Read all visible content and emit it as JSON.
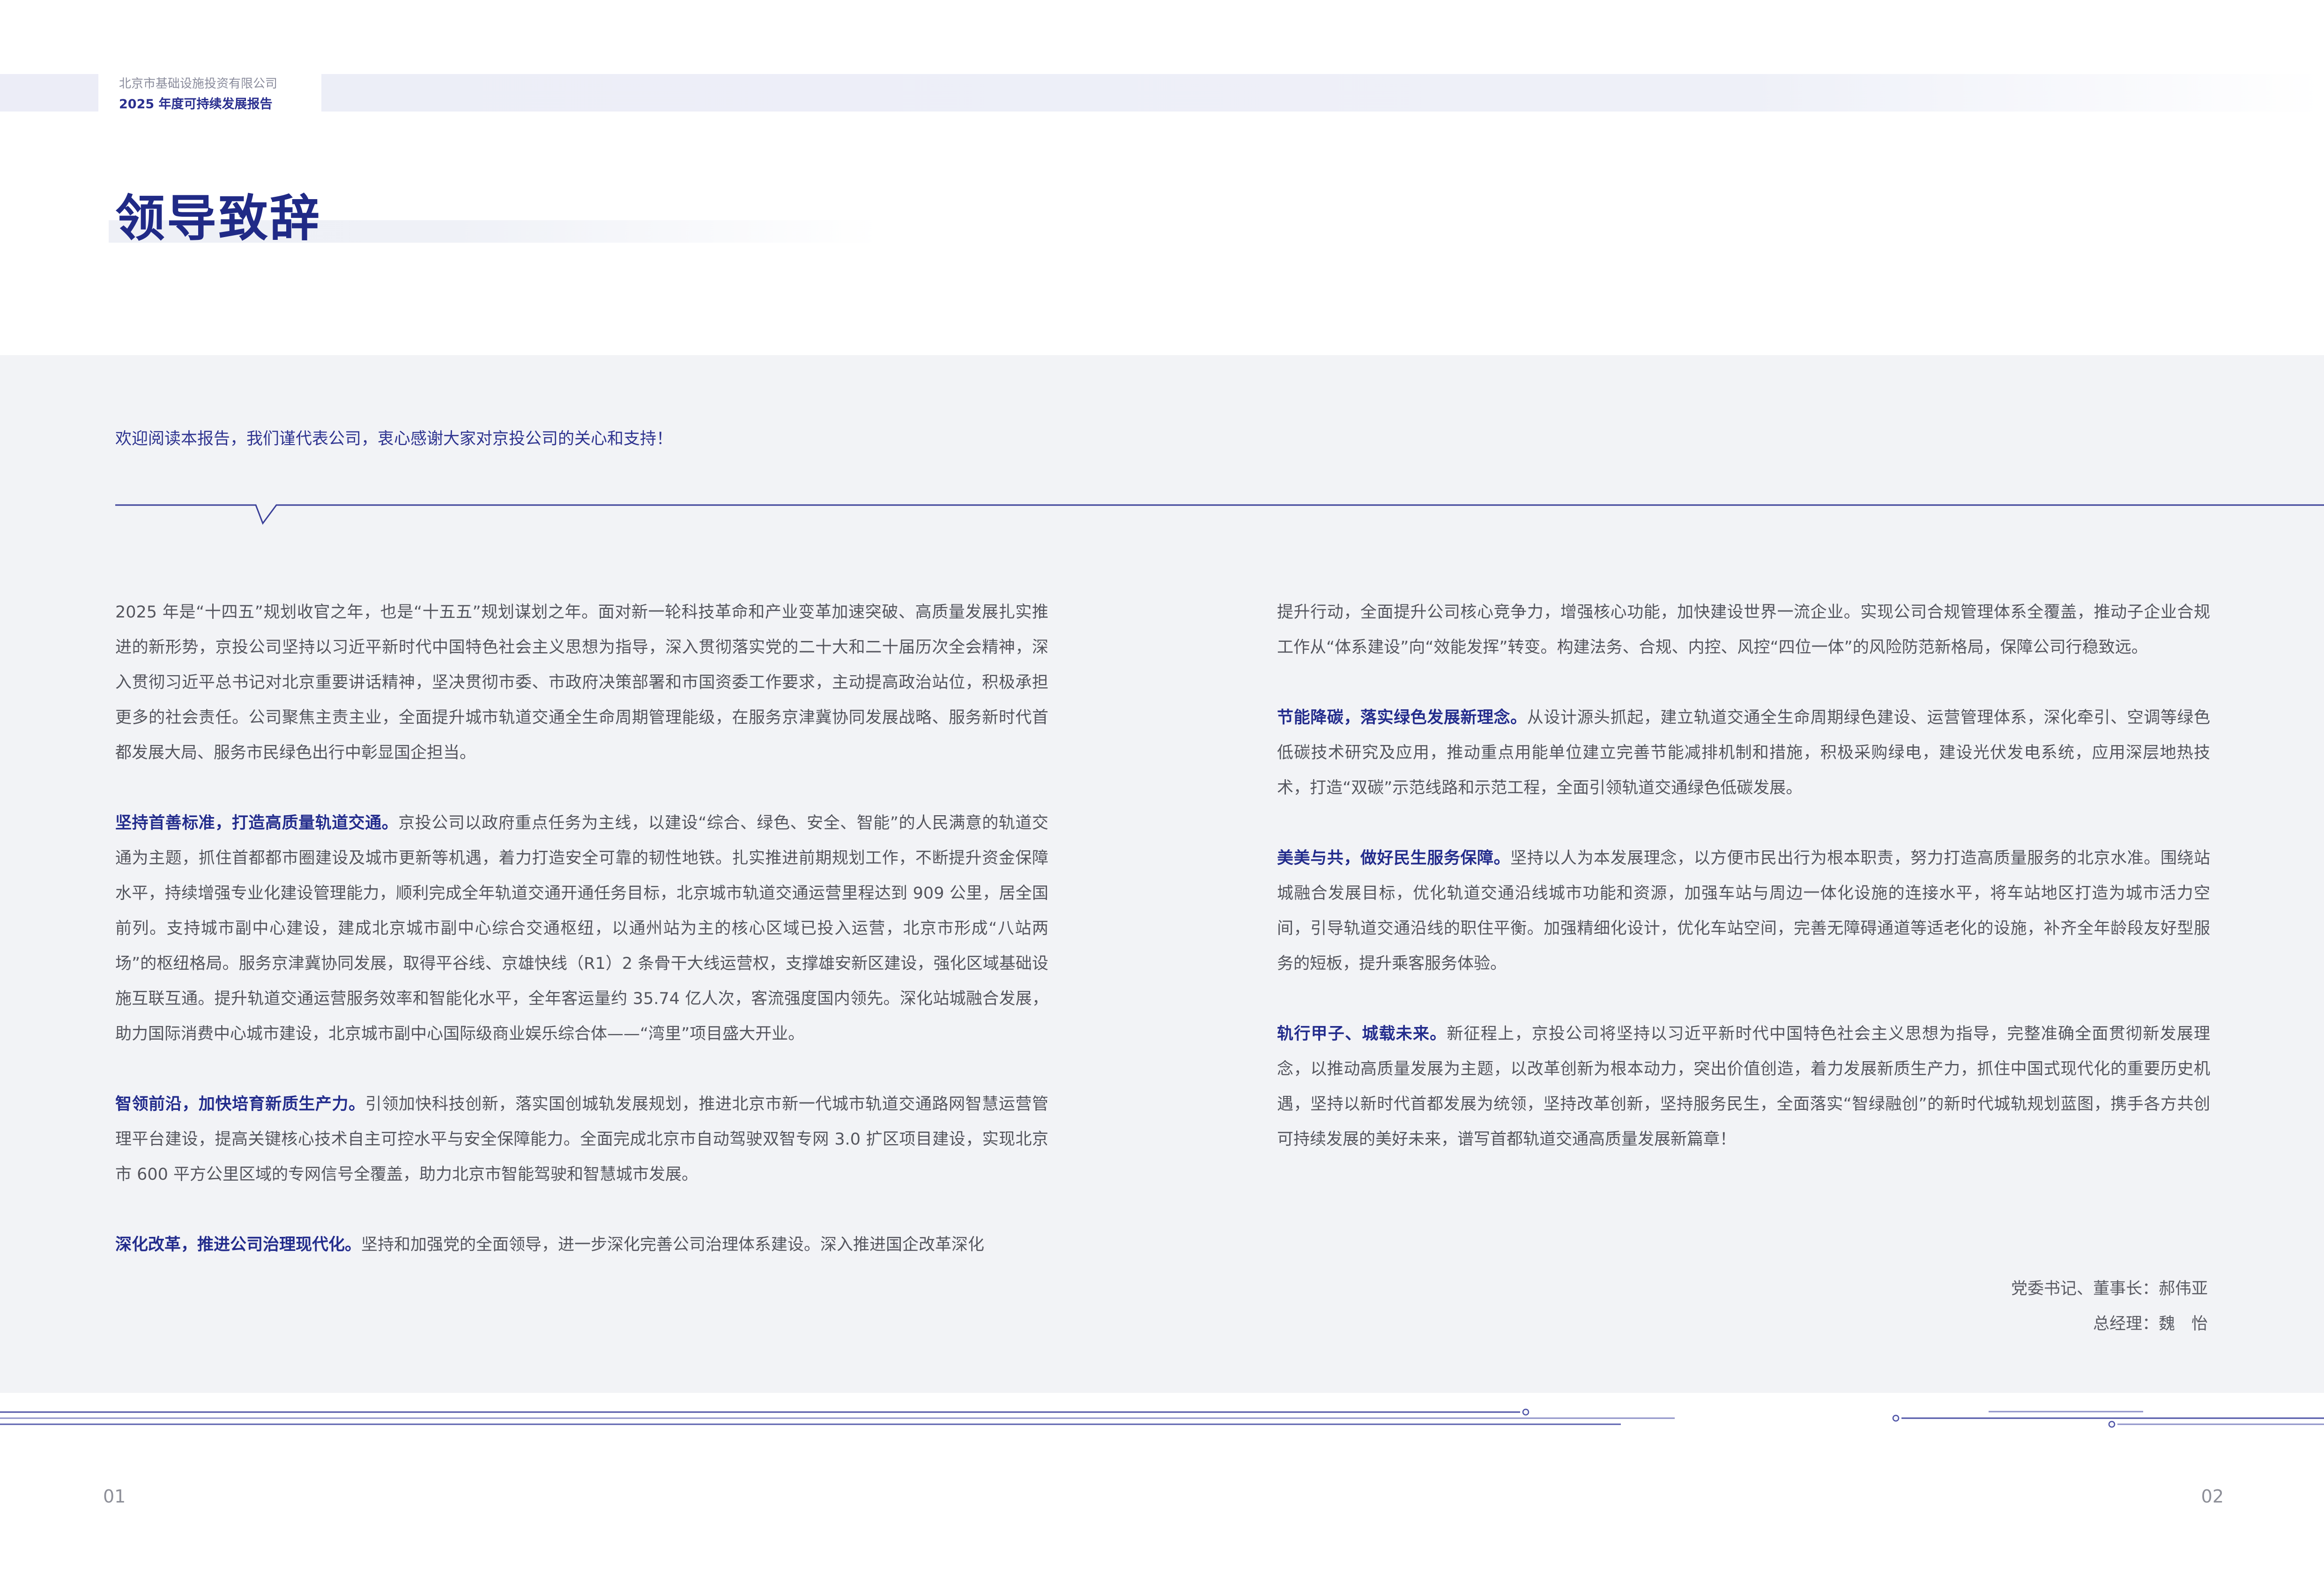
{
  "header": {
    "company": "北京市基础设施投资有限公司",
    "report": "2025 年度可持续发展报告"
  },
  "title": "领导致辞",
  "welcome": "欢迎阅读本报告，我们谨代表公司，衷心感谢大家对京投公司的关心和支持！",
  "left_column": {
    "p1": "2025 年是“十四五”规划收官之年，也是“十五五”规划谋划之年。面对新一轮科技革命和产业变革加速突破、高质量发展扎实推进的新形势，京投公司坚持以习近平新时代中国特色社会主义思想为指导，深入贯彻落实党的二十大和二十届历次全会精神，深入贯彻习近平总书记对北京重要讲话精神，坚决贯彻市委、市政府决策部署和市国资委工作要求，主动提高政治站位，积极承担更多的社会责任。公司聚焦主责主业，全面提升城市轨道交通全生命周期管理能级，在服务京津冀协同发展战略、服务新时代首都发展大局、服务市民绿色出行中彰显国企担当。",
    "p2_lead": "坚持首善标准，打造高质量轨道交通。",
    "p2_body": "京投公司以政府重点任务为主线，以建设“综合、绿色、安全、智能”的人民满意的轨道交通为主题，抓住首都都市圈建设及城市更新等机遇，着力打造安全可靠的韧性地铁。扎实推进前期规划工作，不断提升资金保障水平，持续增强专业化建设管理能力，顺利完成全年轨道交通开通任务目标，北京城市轨道交通运营里程达到 909 公里，居全国前列。支持城市副中心建设，建成北京城市副中心综合交通枢纽，以通州站为主的核心区域已投入运营，北京市形成“八站两场”的枢纽格局。服务京津冀协同发展，取得平谷线、京雄快线（R1）2 条骨干大线运营权，支撑雄安新区建设，强化区域基础设施互联互通。提升轨道交通运营服务效率和智能化水平，全年客运量约 35.74 亿人次，客流强度国内领先。深化站城融合发展，助力国际消费中心城市建设，北京城市副中心国际级商业娱乐综合体——“湾里”项目盛大开业。",
    "p3_lead": "智领前沿，加快培育新质生产力。",
    "p3_body": "引领加快科技创新，落实国创城轨发展规划，推进北京市新一代城市轨道交通路网智慧运营管理平台建设，提高关键核心技术自主可控水平与安全保障能力。全面完成北京市自动驾驶双智专网 3.0 扩区项目建设，实现北京市 600 平方公里区域的专网信号全覆盖，助力北京市智能驾驶和智慧城市发展。",
    "p4_lead": "深化改革，推进公司治理现代化。",
    "p4_body": "坚持和加强党的全面领导，进一步深化完善公司治理体系建设。深入推进国企改革深化"
  },
  "right_column": {
    "p1": "提升行动，全面提升公司核心竞争力，增强核心功能，加快建设世界一流企业。实现公司合规管理体系全覆盖，推动子企业合规工作从“体系建设”向“效能发挥”转变。构建法务、合规、内控、风控“四位一体”的风险防范新格局，保障公司行稳致远。",
    "p2_lead": "节能降碳，落实绿色发展新理念。",
    "p2_body": "从设计源头抓起，建立轨道交通全生命周期绿色建设、运营管理体系，深化牵引、空调等绿色低碳技术研究及应用，推动重点用能单位建立完善节能减排机制和措施，积极采购绿电，建设光伏发电系统，应用深层地热技术，打造“双碳”示范线路和示范工程，全面引领轨道交通绿色低碳发展。",
    "p3_lead": "美美与共，做好民生服务保障。",
    "p3_body": "坚持以人为本发展理念，以方便市民出行为根本职责，努力打造高质量服务的北京水准。围绕站城融合发展目标，优化轨道交通沿线城市功能和资源，加强车站与周边一体化设施的连接水平，将车站地区打造为城市活力空间，引导轨道交通沿线的职住平衡。加强精细化设计，优化车站空间，完善无障碍通道等适老化的设施，补齐全年龄段友好型服务的短板，提升乘客服务体验。",
    "p4_lead": "轨行甲子、城载未来。",
    "p4_body": "新征程上，京投公司将坚持以习近平新时代中国特色社会主义思想为指导，完整准确全面贯彻新发展理念，以推动高质量发展为主题，以改革创新为根本动力，突出价值创造，着力发展新质生产力，抓住中国式现代化的重要历史机遇，坚持以新时代首都发展为统领，坚持改革创新，坚持服务民生，全面落实“智绿融创”的新时代城轨规划蓝图，携手各方共创可持续发展的美好未来，谱写首都轨道交通高质量发展新篇章！"
  },
  "signature": {
    "line1": "党委书记、董事长：郝伟亚",
    "line2": "总经理：魏　怡"
  },
  "page_numbers": {
    "left": "01",
    "right": "02"
  },
  "colors": {
    "brand": "#202a86",
    "accent_line": "#3a3f98",
    "band": "#f2f3f6",
    "header_strip": "#ecedf7"
  }
}
